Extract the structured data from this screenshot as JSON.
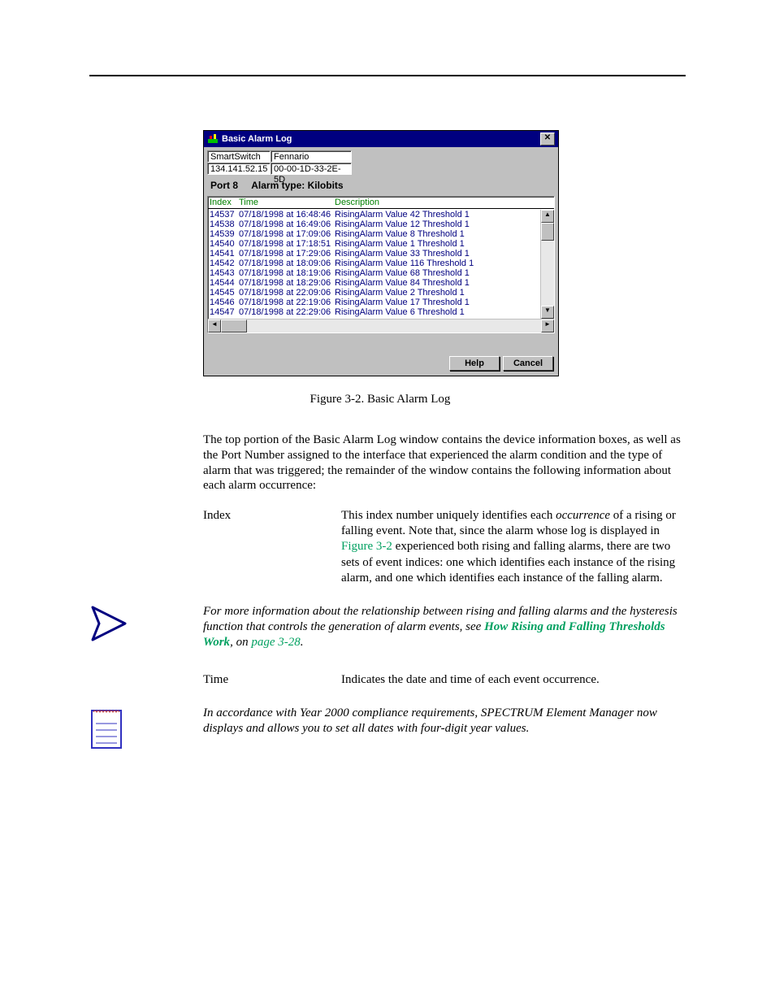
{
  "dialog": {
    "title": "Basic Alarm Log",
    "close_glyph": "✕",
    "device_name": "SmartSwitch",
    "contact": "Fennario",
    "ip": "134.141.52.15",
    "mac": "00-00-1D-33-2E-5D",
    "port_label": "Port 8",
    "alarm_type_label": "Alarm type: Kilobits",
    "columns": {
      "index": "Index",
      "time": "Time",
      "desc": "Description"
    },
    "rows": [
      {
        "index": "14537",
        "time": "07/18/1998 at 16:48:46",
        "desc": "RisingAlarm  Value 42  Threshold 1"
      },
      {
        "index": "14538",
        "time": "07/18/1998 at 16:49:06",
        "desc": "RisingAlarm  Value 12  Threshold 1"
      },
      {
        "index": "14539",
        "time": "07/18/1998 at 17:09:06",
        "desc": "RisingAlarm  Value 8  Threshold 1"
      },
      {
        "index": "14540",
        "time": "07/18/1998 at 17:18:51",
        "desc": "RisingAlarm  Value 1  Threshold 1"
      },
      {
        "index": "14541",
        "time": "07/18/1998 at 17:29:06",
        "desc": "RisingAlarm  Value 33  Threshold 1"
      },
      {
        "index": "14542",
        "time": "07/18/1998 at 18:09:06",
        "desc": "RisingAlarm  Value 116  Threshold 1"
      },
      {
        "index": "14543",
        "time": "07/18/1998 at 18:19:06",
        "desc": "RisingAlarm  Value 68  Threshold 1"
      },
      {
        "index": "14544",
        "time": "07/18/1998 at 18:29:06",
        "desc": "RisingAlarm  Value 84  Threshold 1"
      },
      {
        "index": "14545",
        "time": "07/18/1998 at 22:09:06",
        "desc": "RisingAlarm  Value 2  Threshold 1"
      },
      {
        "index": "14546",
        "time": "07/18/1998 at 22:19:06",
        "desc": "RisingAlarm  Value 17  Threshold 1"
      },
      {
        "index": "14547",
        "time": "07/18/1998 at 22:29:06",
        "desc": "RisingAlarm  Value 6  Threshold 1"
      }
    ],
    "buttons": {
      "help": "Help",
      "cancel": "Cancel"
    }
  },
  "figure_caption": "Figure 3-2.  Basic Alarm Log",
  "para1": "The top portion of the Basic Alarm Log window contains the device information boxes, as well as the Port Number assigned to the interface that experienced the alarm condition and the type of alarm that was triggered; the remainder of the window contains the following information about each alarm occurrence:",
  "def_index_term": "Index",
  "def_index_desc_a": "This index number uniquely identifies each ",
  "def_index_desc_em": "occurrence",
  "def_index_desc_b": " of a rising or falling event. Note that, since the alarm whose log is displayed in ",
  "def_index_link": "Figure 3-2",
  "def_index_desc_c": " experienced both rising and falling alarms, there are two sets of event indices: one which identifies each instance of the rising alarm, and one which identifies each instance of the falling alarm.",
  "tip_body_a": "For more information about the relationship between rising and falling alarms and the hysteresis function that controls the generation of alarm events, see ",
  "tip_link": "How Rising and Falling Thresholds Work",
  "tip_body_b": ", on ",
  "tip_pageref": "page 3-28",
  "tip_body_c": ".",
  "def_time_term": "Time",
  "def_time_desc": "Indicates the date and time of each event occurrence.",
  "note_body": "In accordance with Year 2000 compliance requirements, SPECTRUM Element Manager now displays and allows you to set all dates with four-digit year values."
}
